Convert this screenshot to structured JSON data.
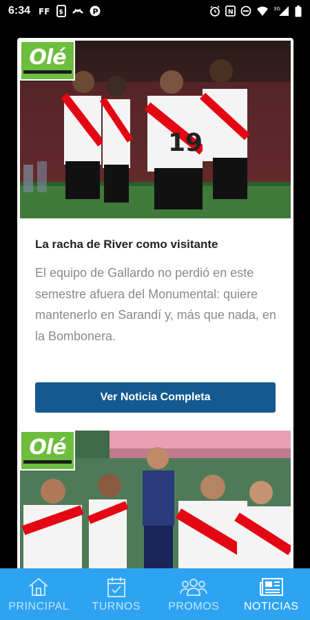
{
  "status_bar": {
    "time": "6:34",
    "network_label": "3G"
  },
  "articles": [
    {
      "logo_text": "Olé",
      "title": "La racha de River como visitante",
      "summary": "El equipo de Gallardo no perdió en este semestre afuera del Monumental: quiere mantenerlo en Sarandí y, más que nada, en la Bombonera.",
      "button_label": "Ver Noticia Completa"
    },
    {
      "logo_text": "Olé"
    }
  ],
  "bottom_nav": {
    "items": [
      {
        "label": "PRINCIPAL",
        "icon": "home-icon"
      },
      {
        "label": "TURNOS",
        "icon": "calendar-check-icon"
      },
      {
        "label": "PROMOS",
        "icon": "group-icon"
      },
      {
        "label": "NOTICIAS",
        "icon": "newspaper-icon"
      }
    ],
    "active_index": 3
  },
  "colors": {
    "nav_background": "#2ea3f2",
    "button_background": "#145a91",
    "logo_green": "#6dbd3f",
    "jersey_red": "#e30613"
  }
}
